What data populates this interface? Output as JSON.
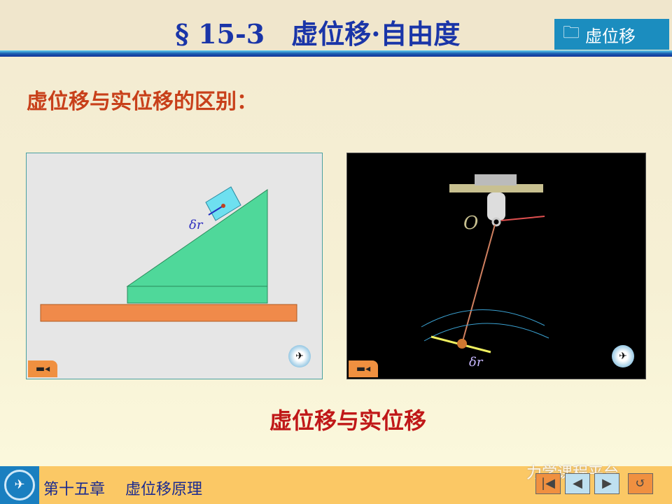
{
  "header": {
    "title": "§ 15-3　虚位移·自由度",
    "tag": "虚位移",
    "tag_icon": "folder-icon"
  },
  "subtitle": "虚位移与实位移的区别：",
  "left_panel": {
    "label": "δr",
    "icon_camera": "camera-icon",
    "icon_globe": "globe-icon"
  },
  "right_panel": {
    "pivot_label": "O",
    "label": "δr",
    "icon_camera": "camera-icon",
    "icon_globe": "globe-icon"
  },
  "caption": "虚位移与实位移",
  "footer": {
    "chapter": "第十五章　 虚位移原理",
    "watermark": "力学课程平台",
    "nav": [
      "first",
      "prev",
      "next",
      "return"
    ]
  },
  "colors": {
    "title": "#1a35a8",
    "subtitle": "#c8401a",
    "caption": "#c01818",
    "footer": "#fbc865"
  }
}
